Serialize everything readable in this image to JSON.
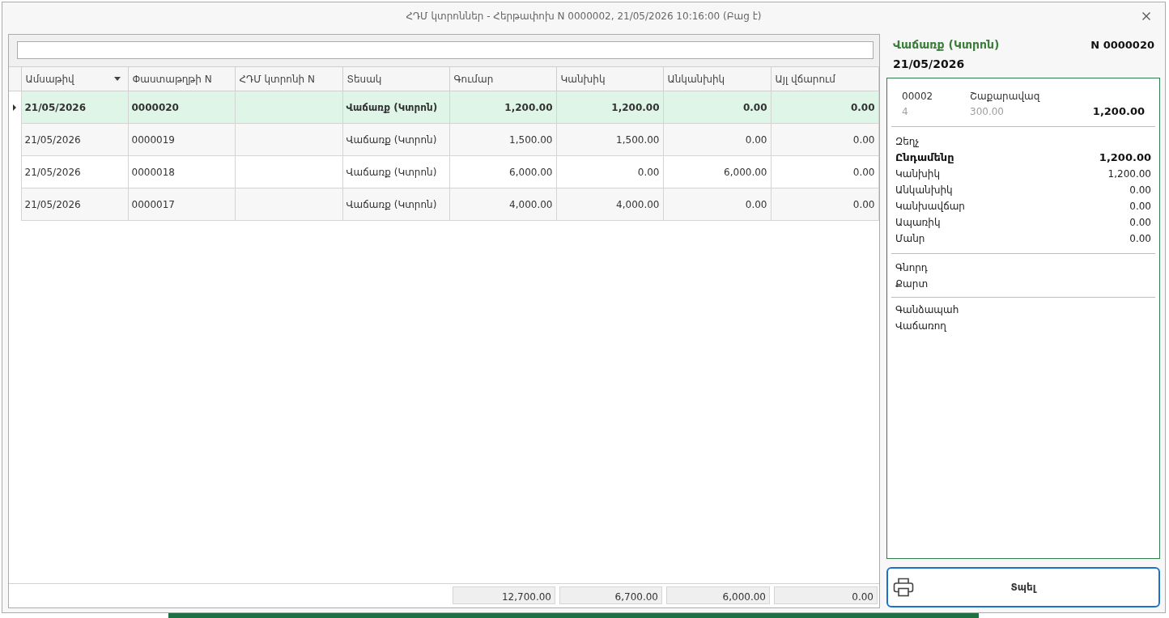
{
  "window": {
    "title": "ՀԴՄ կտրոններ - Հերթափոխ N 0000002, 21/05/2026 10:16:00 (Բաց է)"
  },
  "table": {
    "columns": [
      {
        "label": "Ամսաթիվ",
        "kind": "text",
        "sorted": true
      },
      {
        "label": "Փաստաթղթի N",
        "kind": "text",
        "sorted": false
      },
      {
        "label": "ՀԴՄ կտրոնի N",
        "kind": "text",
        "sorted": false
      },
      {
        "label": "Տեսակ",
        "kind": "text",
        "sorted": false
      },
      {
        "label": "Գումար",
        "kind": "number",
        "sorted": false
      },
      {
        "label": "Կանխիկ",
        "kind": "number",
        "sorted": false
      },
      {
        "label": "Անկանխիկ",
        "kind": "number",
        "sorted": false
      },
      {
        "label": "Այլ վճարում",
        "kind": "number",
        "sorted": false
      }
    ],
    "rows": [
      {
        "selected": true,
        "date": "21/05/2026",
        "document_no": "0000020",
        "type": "Վաճառք (Կտրոն)",
        "amount": "1,200.00",
        "cash": "1,200.00",
        "non_cash": "0.00",
        "other_payment": "0.00"
      },
      {
        "selected": false,
        "date": "21/05/2026",
        "document_no": "0000019",
        "type": "Վաճառք (Կտրոն)",
        "amount": "1,500.00",
        "cash": "1,500.00",
        "non_cash": "0.00",
        "other_payment": "0.00"
      },
      {
        "selected": false,
        "date": "21/05/2026",
        "document_no": "0000018",
        "type": "Վաճառք (Կտրոն)",
        "amount": "6,000.00",
        "cash": "0.00",
        "non_cash": "6,000.00",
        "other_payment": "0.00"
      },
      {
        "selected": false,
        "date": "21/05/2026",
        "document_no": "0000017",
        "type": "Վաճառք (Կտրոն)",
        "amount": "4,000.00",
        "cash": "4,000.00",
        "non_cash": "0.00",
        "other_payment": "0.00"
      }
    ],
    "totals": {
      "amount": "12,700.00",
      "cash": "6,700.00",
      "non_cash": "6,000.00",
      "other_payment": "0.00"
    }
  },
  "receipt": {
    "title": "Վաճառք (Կտրոն)",
    "number": "N 0000020",
    "date": "21/05/2026",
    "items": [
      {
        "code": "00002",
        "name": "Շաքարավազ",
        "quantity": "4",
        "price": "300.00",
        "total": "1,200.00"
      }
    ],
    "summary": [
      {
        "label": "Զեղչ",
        "bold": false
      },
      {
        "label": "Ընդամենը",
        "value": "1,200.00",
        "bold": true
      },
      {
        "label": "Կանխիկ",
        "value": "1,200.00",
        "bold": false
      },
      {
        "label": "Անկանխիկ",
        "value": "0.00",
        "bold": false
      },
      {
        "label": "Կանխավճար",
        "value": "0.00",
        "bold": false
      },
      {
        "label": "Ապառիկ",
        "value": "0.00",
        "bold": false
      },
      {
        "label": "Մանր",
        "value": "0.00",
        "bold": false
      }
    ],
    "customer_fields": [
      {
        "label": "Գնորդ"
      },
      {
        "label": "Քարտ"
      }
    ],
    "staff_fields": [
      {
        "label": "Գանձապահ"
      },
      {
        "label": "Վաճառող"
      }
    ]
  },
  "print_button": {
    "label": "Տպել"
  }
}
